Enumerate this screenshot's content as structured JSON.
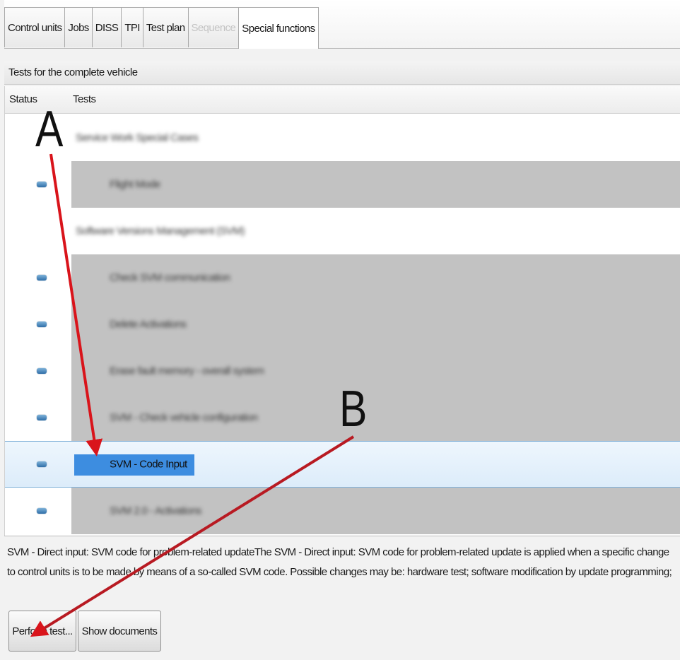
{
  "tabs": [
    {
      "label": "Control units",
      "state": "normal"
    },
    {
      "label": "Jobs",
      "state": "normal"
    },
    {
      "label": "DISS",
      "state": "normal"
    },
    {
      "label": "TPI",
      "state": "normal"
    },
    {
      "label": "Test plan",
      "state": "normal"
    },
    {
      "label": "Sequence",
      "state": "disabled"
    },
    {
      "label": "Special functions",
      "state": "active"
    }
  ],
  "group_title": "Tests for the complete vehicle",
  "columns": {
    "status": "Status",
    "tests": "Tests"
  },
  "rows": [
    {
      "label": "Service Work Special Cases",
      "kind": "group",
      "status_icon": false
    },
    {
      "label": "Flight Mode",
      "kind": "item",
      "status_icon": true
    },
    {
      "label": "Software Versions Management (SVM)",
      "kind": "group",
      "status_icon": false
    },
    {
      "label": "Check SVM communication",
      "kind": "item",
      "status_icon": true
    },
    {
      "label": "Delete Activations",
      "kind": "item",
      "status_icon": true
    },
    {
      "label": "Erase fault memory - overall system",
      "kind": "item",
      "status_icon": true
    },
    {
      "label": "SVM - Check vehicle configuration",
      "kind": "item",
      "status_icon": true
    },
    {
      "label": "SVM - Code Input",
      "kind": "item",
      "status_icon": true,
      "selected": true
    },
    {
      "label": "SVM 2.0 - Activations",
      "kind": "item",
      "status_icon": true
    }
  ],
  "description": {
    "line1": "SVM - Direct input: SVM code for problem-related updateThe SVM - Direct input: SVM code for problem-related update is applied when a specific change",
    "line2": "to control units is to be made by means of a so-called SVM code. Possible changes may be: hardware test; software modification by update programming;"
  },
  "buttons": {
    "perform": "Perform test...",
    "documents": "Show documents"
  },
  "annotations": {
    "a": "A",
    "b": "B",
    "arrow_color": "#d9141b"
  },
  "colors": {
    "status_icon": "#3b7fc0",
    "selection": "#3d8de0",
    "row_gray": "#c2c2c2"
  }
}
